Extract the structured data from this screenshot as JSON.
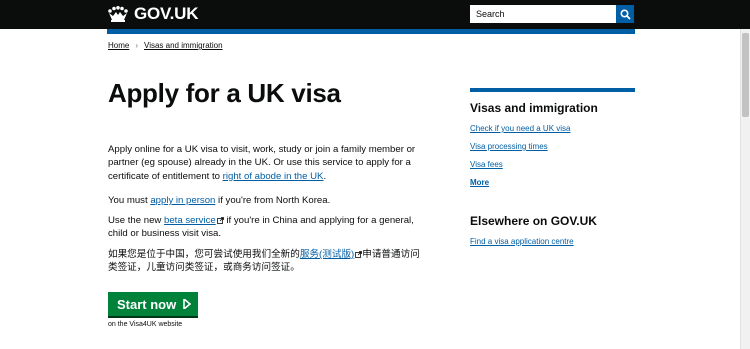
{
  "header": {
    "logo_text": "GOV.UK",
    "search_placeholder": "Search"
  },
  "breadcrumb": [
    "Home",
    "Visas and immigration"
  ],
  "page": {
    "title": "Apply for a UK visa",
    "intro_text": "Apply online for a UK visa to visit, work, study or join a family member or partner (eg spouse) already in the UK. Or use this service to apply for a certificate of entitlement to ",
    "intro_link": "right of abode in the UK",
    "intro_end": ".",
    "nk_before": "You must ",
    "nk_link": "apply in person",
    "nk_after": " if you're from North Korea.",
    "china_before": "Use the new ",
    "china_link": "beta service",
    "china_after": " if you're in China and applying for a general, child or business visit visa.",
    "zh_before": "如果您是位于中国，您可尝试使用我们全新的",
    "zh_link": "服务(测试版)",
    "zh_after": "申请普通访问类签证，儿童访问类签证，或商务访问签证。",
    "start_label": "Start now",
    "start_note": "on the Visa4UK website"
  },
  "sidebar": {
    "heading": "Visas and immigration",
    "links": [
      "Check if you need a UK visa",
      "Visa processing times",
      "Visa fees"
    ],
    "more": "More",
    "elsewhere_heading": "Elsewhere on GOV.UK",
    "elsewhere_links": [
      "Find a visa application centre"
    ]
  },
  "colors": {
    "header_bg": "#0b0c0c",
    "brand_blue": "#005ea5",
    "start_green": "#00823b"
  }
}
